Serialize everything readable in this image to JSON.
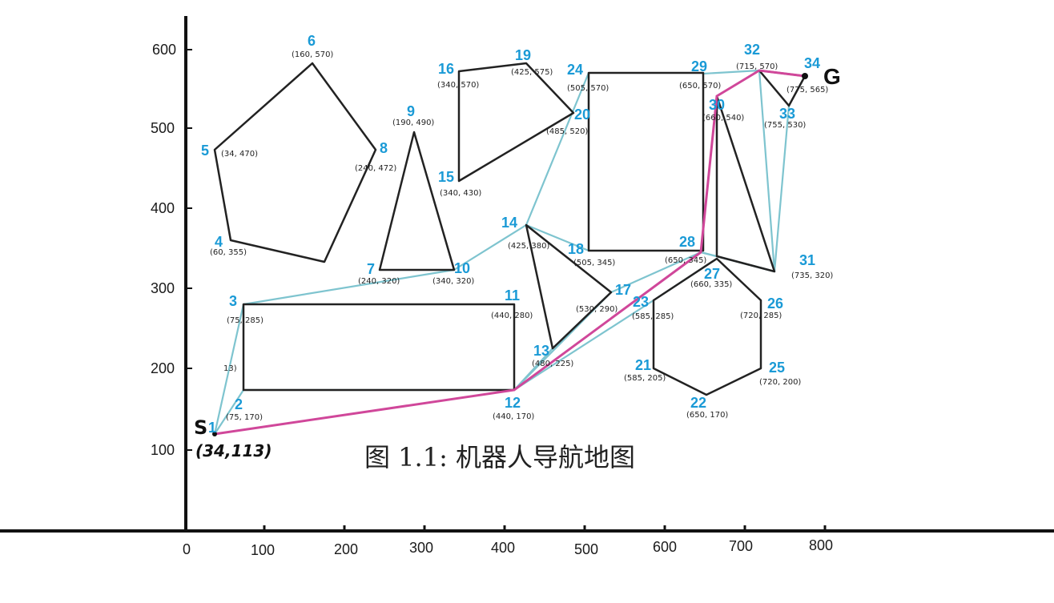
{
  "caption": "图 1.1: 机器人导航地图",
  "axes": {
    "x_ticks": [
      "0",
      "100",
      "200",
      "300",
      "400",
      "500",
      "600",
      "700",
      "800"
    ],
    "y_ticks": [
      "100",
      "200",
      "300",
      "400",
      "500",
      "600"
    ]
  },
  "start": {
    "label": "S",
    "id": "1",
    "coord": "(34,113)"
  },
  "goal": {
    "label": "G"
  },
  "colors": {
    "obstacle": "#222222",
    "visibility": "#7ec4cf",
    "path": "#d0479a",
    "vertex_label": "#1a9ad6"
  },
  "vertices": [
    {
      "id": "1",
      "coord": ""
    },
    {
      "id": "2",
      "coord": "(75, 170)"
    },
    {
      "id": "3",
      "coord": "(75, 285)"
    },
    {
      "id": "4",
      "coord": "(60, 355)"
    },
    {
      "id": "5",
      "coord": "(34, 470)"
    },
    {
      "id": "6",
      "coord": "(160, 570)"
    },
    {
      "id": "7",
      "coord": "(240, 320)"
    },
    {
      "id": "8",
      "coord": "(240, 472)"
    },
    {
      "id": "9",
      "coord": "(190, 490)"
    },
    {
      "id": "10",
      "coord": "(340, 320)"
    },
    {
      "id": "11",
      "coord": "(440, 280)"
    },
    {
      "id": "12",
      "coord": "(440, 170)"
    },
    {
      "id": "13",
      "coord": "(480, 225)"
    },
    {
      "id": "14",
      "coord": "(425, 380)"
    },
    {
      "id": "15",
      "coord": "(340, 430)"
    },
    {
      "id": "16",
      "coord": "(340, 570)"
    },
    {
      "id": "17",
      "coord": "(530, 290)"
    },
    {
      "id": "18",
      "coord": "(505, 345)"
    },
    {
      "id": "19",
      "coord": "(425, 575)"
    },
    {
      "id": "20",
      "coord": "(485, 520)"
    },
    {
      "id": "21",
      "coord": "(585, 205)"
    },
    {
      "id": "22",
      "coord": "(650, 170)"
    },
    {
      "id": "23",
      "coord": "(585, 285)"
    },
    {
      "id": "24",
      "coord": "(505, 570)"
    },
    {
      "id": "25",
      "coord": "(720, 200)"
    },
    {
      "id": "26",
      "coord": "(720, 285)"
    },
    {
      "id": "27",
      "coord": "(660, 335)"
    },
    {
      "id": "28",
      "coord": "(650, 345)"
    },
    {
      "id": "29",
      "coord": "(650, 570)"
    },
    {
      "id": "30",
      "coord": "(660, 540)"
    },
    {
      "id": "31",
      "coord": "(735, 320)"
    },
    {
      "id": "32",
      "coord": "(715, 570)"
    },
    {
      "id": "33",
      "coord": "(755, 530)"
    },
    {
      "id": "34",
      "coord": "(775, 565)"
    }
  ],
  "stray_label": "13)"
}
